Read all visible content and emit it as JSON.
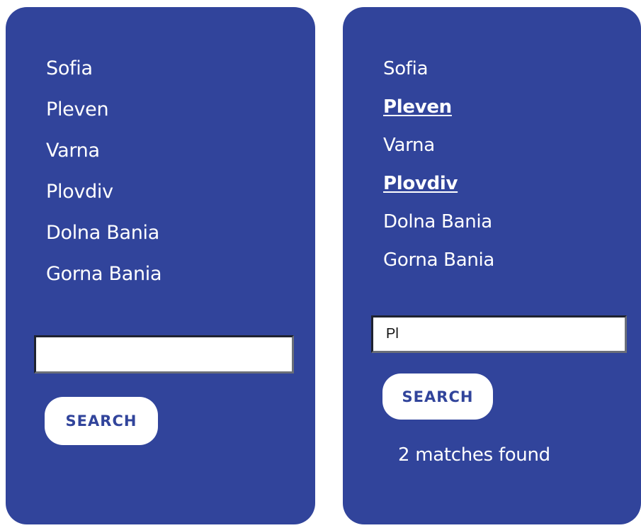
{
  "before": {
    "towns": [
      "Sofia",
      "Pleven",
      "Varna",
      "Plovdiv",
      "Dolna Bania",
      "Gorna Bania"
    ],
    "search_value": "",
    "search_button_label": "SEARCH"
  },
  "after": {
    "towns": [
      "Sofia",
      "Pleven",
      "Varna",
      "Plovdiv",
      "Dolna Bania",
      "Gorna Bania"
    ],
    "highlighted": [
      "Pleven",
      "Plovdiv"
    ],
    "search_value": "Pl",
    "search_button_label": "SEARCH",
    "result_text": "2 matches found"
  },
  "colors": {
    "panel": "#31449b",
    "text": "#ffffff",
    "button_text": "#31449b"
  }
}
